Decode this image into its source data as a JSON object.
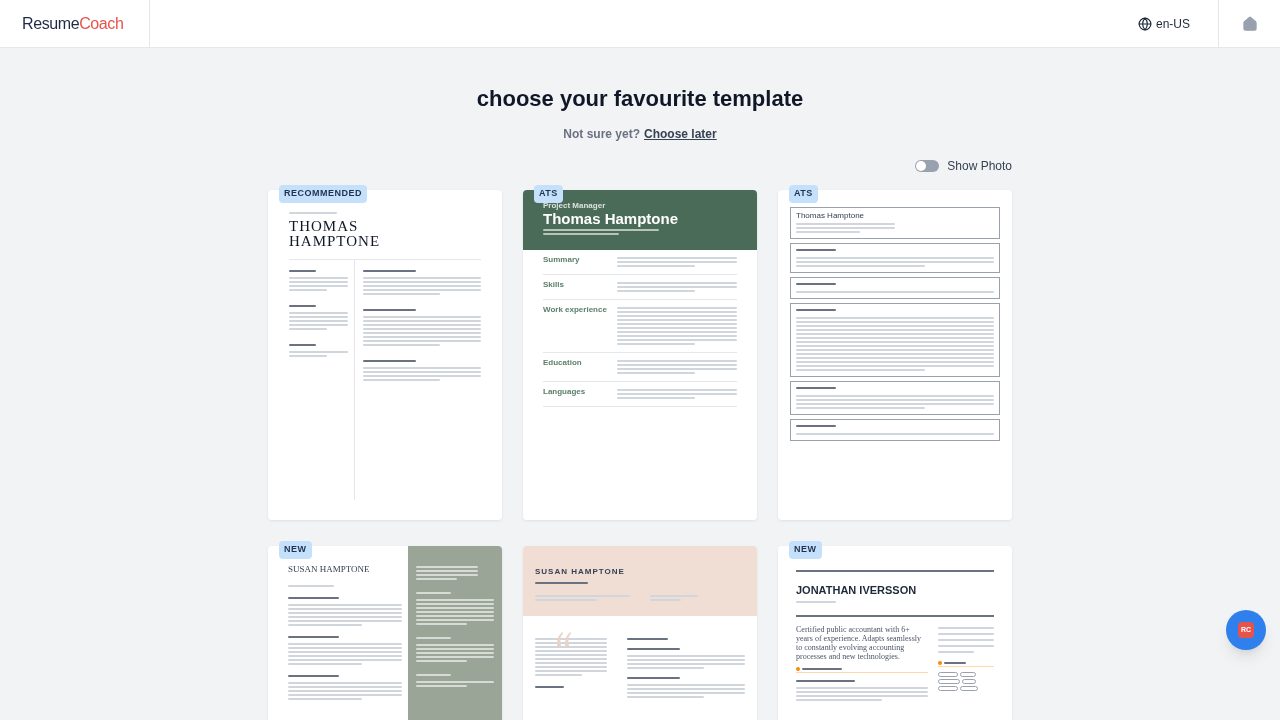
{
  "header": {
    "logo": [
      "Resume",
      "Coach"
    ],
    "language": "en-US"
  },
  "title": "choose your favourite template",
  "subtitle": {
    "text": "Not sure yet?",
    "link": "Choose later"
  },
  "show_photo": {
    "label": "Show Photo",
    "on": false
  },
  "templates": [
    {
      "kind": "classic",
      "badge": "RECOMMENDED",
      "name": "THOMAS HAMPTONE"
    },
    {
      "kind": "banner",
      "badge": "ATS",
      "role": "Project Manager",
      "name": "Thomas Hamptone",
      "sections": [
        {
          "heading": "Summary"
        },
        {
          "heading": "Skills"
        },
        {
          "heading": "Work experience"
        },
        {
          "heading": "Education"
        },
        {
          "heading": "Languages"
        }
      ]
    },
    {
      "kind": "boxed",
      "badge": "ATS",
      "name": "Thomas Hamptone"
    },
    {
      "kind": "sidebar",
      "badge": "NEW",
      "name": "SUSAN HAMPTONE"
    },
    {
      "kind": "blush",
      "name": "SUSAN HAMPTONE"
    },
    {
      "kind": "modern",
      "badge": "NEW",
      "name": "JONATHAN IVERSSON",
      "summary": "Certified public accountant with 6+ years of experience. Adapts seamlessly to constantly evolving accounting processes and new technologies."
    }
  ],
  "chat_button": {
    "text": "RC"
  }
}
